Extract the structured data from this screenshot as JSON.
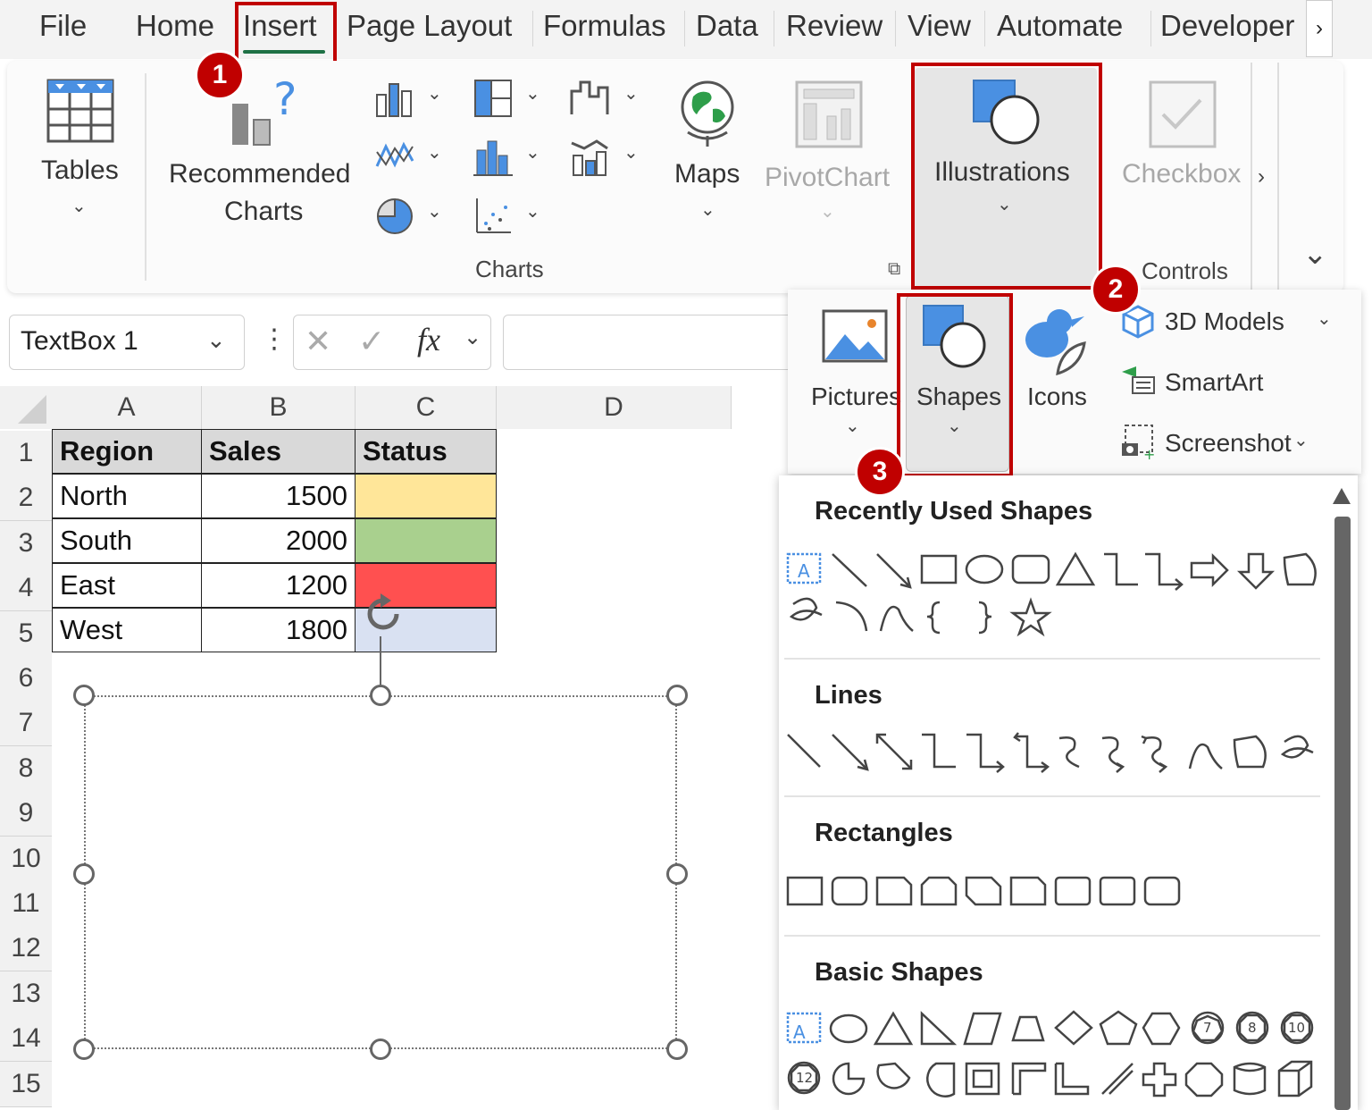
{
  "menu": {
    "tabs": [
      "File",
      "Home",
      "Insert",
      "Page Layout",
      "Formulas",
      "Data",
      "Review",
      "View",
      "Automate",
      "Developer"
    ],
    "overflow": "›",
    "active": "Insert"
  },
  "ribbon": {
    "tables": {
      "label": "Tables"
    },
    "recommended_charts": {
      "line1": "Recommended",
      "line2": "Charts"
    },
    "charts_group": "Charts",
    "maps": {
      "label": "Maps"
    },
    "pivotchart": {
      "label": "PivotChart"
    },
    "illustrations": {
      "label": "Illustrations"
    },
    "checkbox": {
      "label": "Checkbox"
    },
    "controls_group": "Controls",
    "more": "›",
    "collapse": "⌄"
  },
  "formula_bar": {
    "name_box": "TextBox 1",
    "fx": "fx",
    "value": ""
  },
  "illustrations_menu": {
    "pictures": "Pictures",
    "shapes": "Shapes",
    "icons": "Icons",
    "models_3d": "3D Models",
    "smartart": "SmartArt",
    "screenshot": "Screenshot"
  },
  "shapes_gallery": {
    "sections": [
      "Recently Used Shapes",
      "Lines",
      "Rectangles",
      "Basic Shapes"
    ],
    "numbered_shapes": [
      "7",
      "8",
      "10",
      "12"
    ],
    "textbox_glyph": "A"
  },
  "sheet": {
    "columns": [
      "A",
      "B",
      "C",
      "D"
    ],
    "rows": [
      "1",
      "2",
      "3",
      "4",
      "5",
      "6",
      "7",
      "8",
      "9",
      "10",
      "11",
      "12",
      "13",
      "14",
      "15"
    ],
    "header": [
      "Region",
      "Sales",
      "Status"
    ],
    "data": [
      {
        "region": "North",
        "sales": "1500",
        "status_color": "#ffe699"
      },
      {
        "region": "South",
        "sales": "2000",
        "status_color": "#a9d08e"
      },
      {
        "region": "East",
        "sales": "1200",
        "status_color": "#ff5050"
      },
      {
        "region": "West",
        "sales": "1800",
        "status_color": "#d9e1f2"
      }
    ]
  },
  "callouts": [
    "1",
    "2",
    "3"
  ],
  "colors": {
    "accent_red": "#c00000",
    "excel_green": "#1e7145",
    "icon_blue": "#4a90e2"
  }
}
